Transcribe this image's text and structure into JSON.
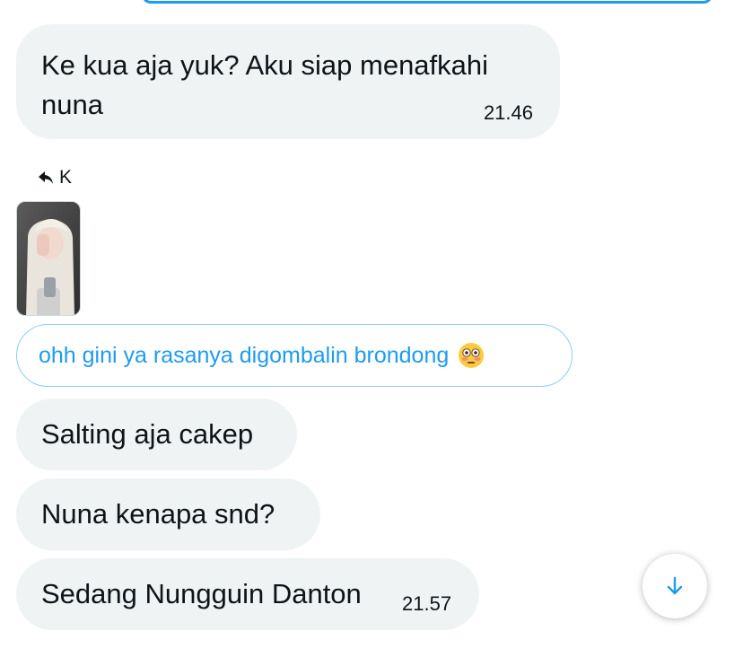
{
  "messages": [
    {
      "text": "Ke kua aja yuk? Aku siap menafkahi nuna",
      "time": "21.46"
    },
    {
      "text": "Salting aja cakep"
    },
    {
      "text": "Nuna kenapa snd?"
    },
    {
      "text": "Sedang Nungguin Danton",
      "time": "21.57"
    }
  ],
  "reply": {
    "label": "K",
    "quote_text": "ohh gini ya rasanya digombalin brondong",
    "emoji": "flushed-face"
  },
  "icons": {
    "reply": "reply-arrow-icon",
    "scroll_down": "arrow-down-icon"
  },
  "colors": {
    "accent": "#1d9bf0",
    "bubble_bg": "#eff3f4",
    "quote_border": "#8ecdf8"
  }
}
